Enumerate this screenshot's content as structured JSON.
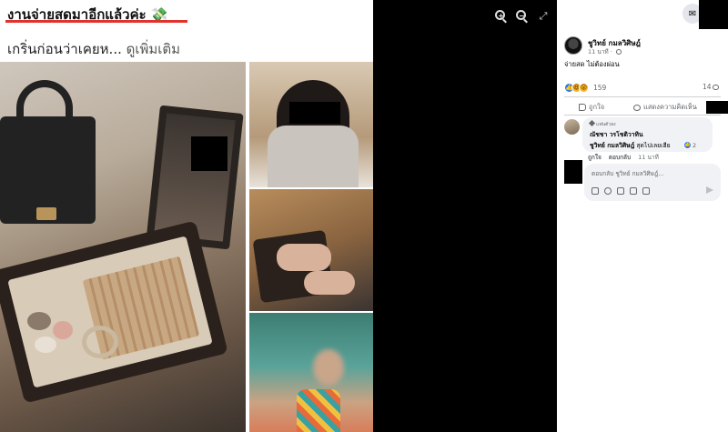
{
  "post": {
    "headline": "งานจ่ายสดมาอีกแล้วค่ะ 💸",
    "subline": "เกริ่นก่อนว่าเคยห...",
    "see_more": " ดูเพิ่มเติม"
  },
  "viewer": {
    "zoom_in_icon": "zoom-in-icon",
    "zoom_out_icon": "zoom-out-icon",
    "expand_icon": "expand-icon",
    "expand_glyph": "⤢"
  },
  "topbar": {
    "messenger_glyph": "✉",
    "bell_glyph": "●"
  },
  "author": {
    "name": "ชูวิทย์ กมลวิศิษฎ์",
    "time": "11 นาที · "
  },
  "post_text": "จ่ายสด ไม่ต้องผ่อน",
  "reactions": {
    "like_glyph": "👍",
    "haha_glyph": "😆",
    "wow_glyph": "😮",
    "count": "159"
  },
  "comment_count": "14",
  "actions": {
    "like": "ถูกใจ",
    "comment": "แสดงความคิดเห็น"
  },
  "comment": {
    "badge": "แฟนตัวยง",
    "author": "ณัชชา วรโชติวาทิน",
    "mention": "ชูวิทย์ กมลวิศิษฎ์",
    "text": " สุดไปเลยเฮีย",
    "like_count": "2",
    "like_action": "ถูกใจ",
    "reply_action": "ตอบกลับ",
    "time": "11 นาที"
  },
  "reply": {
    "placeholder": "ตอบกลับ ชูวิทย์ กมลวิศิษฎ์..."
  }
}
